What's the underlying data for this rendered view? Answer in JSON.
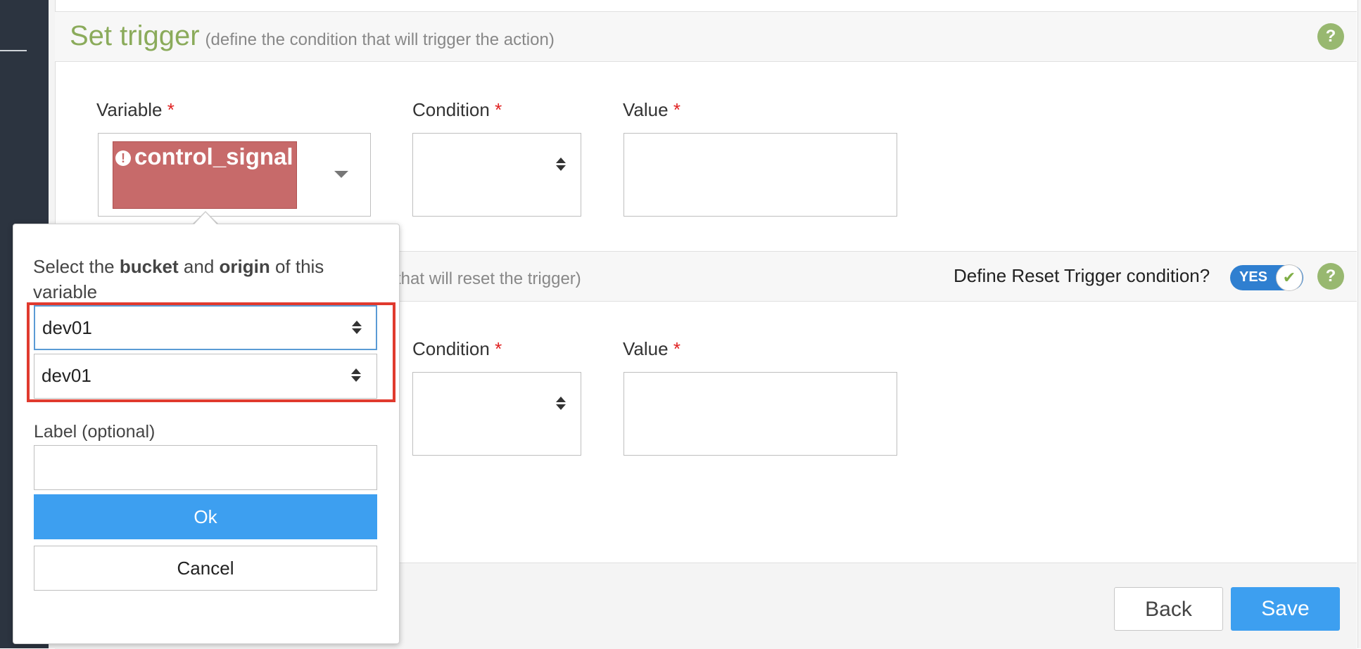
{
  "trigger": {
    "title": "Set trigger",
    "subtitle": "(define the condition that will trigger the action)",
    "help_icon": "help-icon",
    "variable_label": "Variable",
    "condition_label": "Condition",
    "value_label": "Value",
    "required_marker": "*",
    "variable_chip": "control_signal",
    "chip_icon": "!"
  },
  "reset": {
    "subtitle_fragment": "n that will reset the trigger)",
    "define_label": "Define Reset Trigger condition?",
    "toggle_text": "YES",
    "toggle_check": "✔",
    "condition_label": "Condition",
    "value_label": "Value",
    "required_marker": "*"
  },
  "popover": {
    "text_part1": "Select the ",
    "bucket_word": "bucket",
    "text_part2": " and ",
    "origin_word": "origin",
    "text_part3": " of this variable",
    "bucket_value": "dev01",
    "origin_value": "dev01",
    "label_optional": "Label (optional)",
    "ok_label": "Ok",
    "cancel_label": "Cancel"
  },
  "footer": {
    "back_label": "Back",
    "save_label": "Save"
  },
  "colors": {
    "accent_blue": "#3d9ff0",
    "title_green": "#8bab5b",
    "error_red": "#c76a6a",
    "highlight_red": "#e03a2e"
  }
}
